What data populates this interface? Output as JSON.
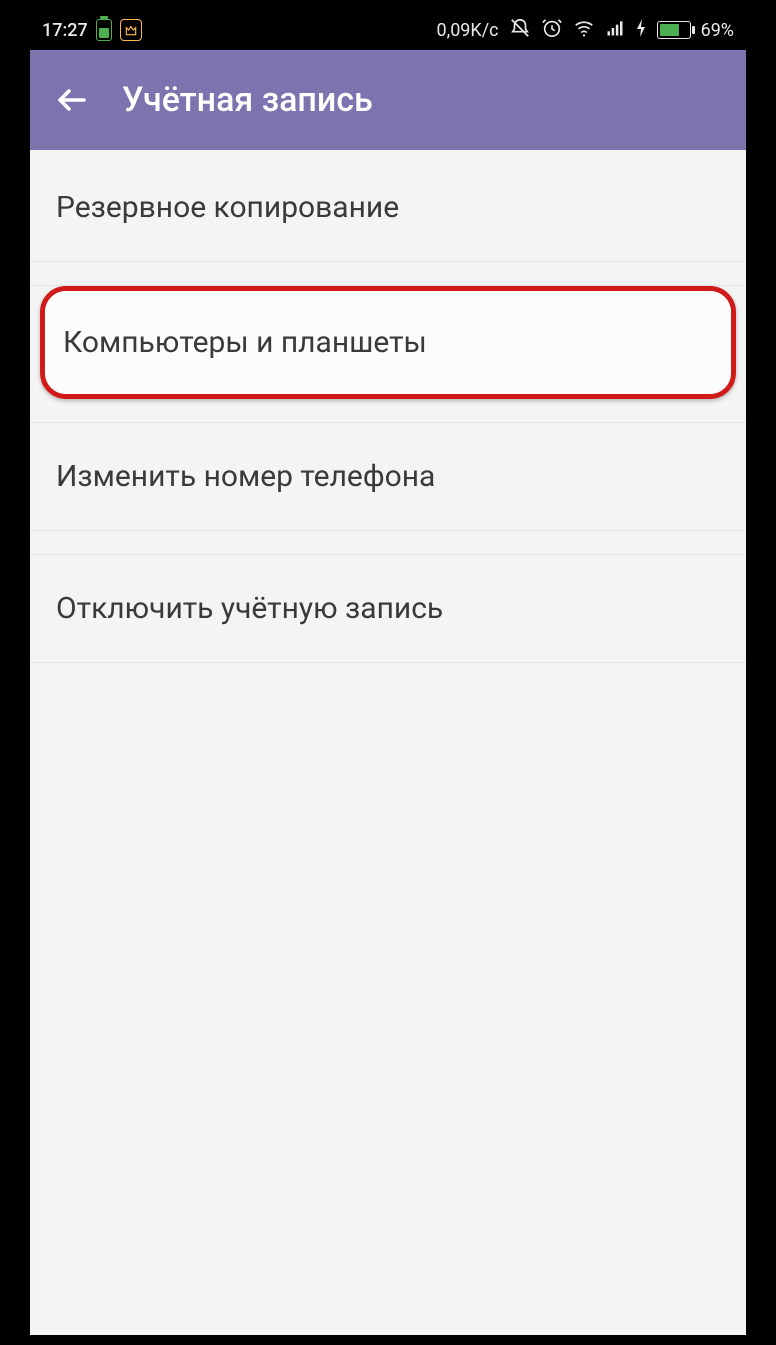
{
  "statusbar": {
    "time": "17:27",
    "data_rate": "0,09K/c",
    "battery_pct": "69%"
  },
  "appbar": {
    "title": "Учётная запись"
  },
  "settings": {
    "backup": "Резервное копирование",
    "computers_tablets": "Компьютеры и планшеты",
    "change_phone": "Изменить номер телефона",
    "deactivate": "Отключить учётную запись"
  }
}
